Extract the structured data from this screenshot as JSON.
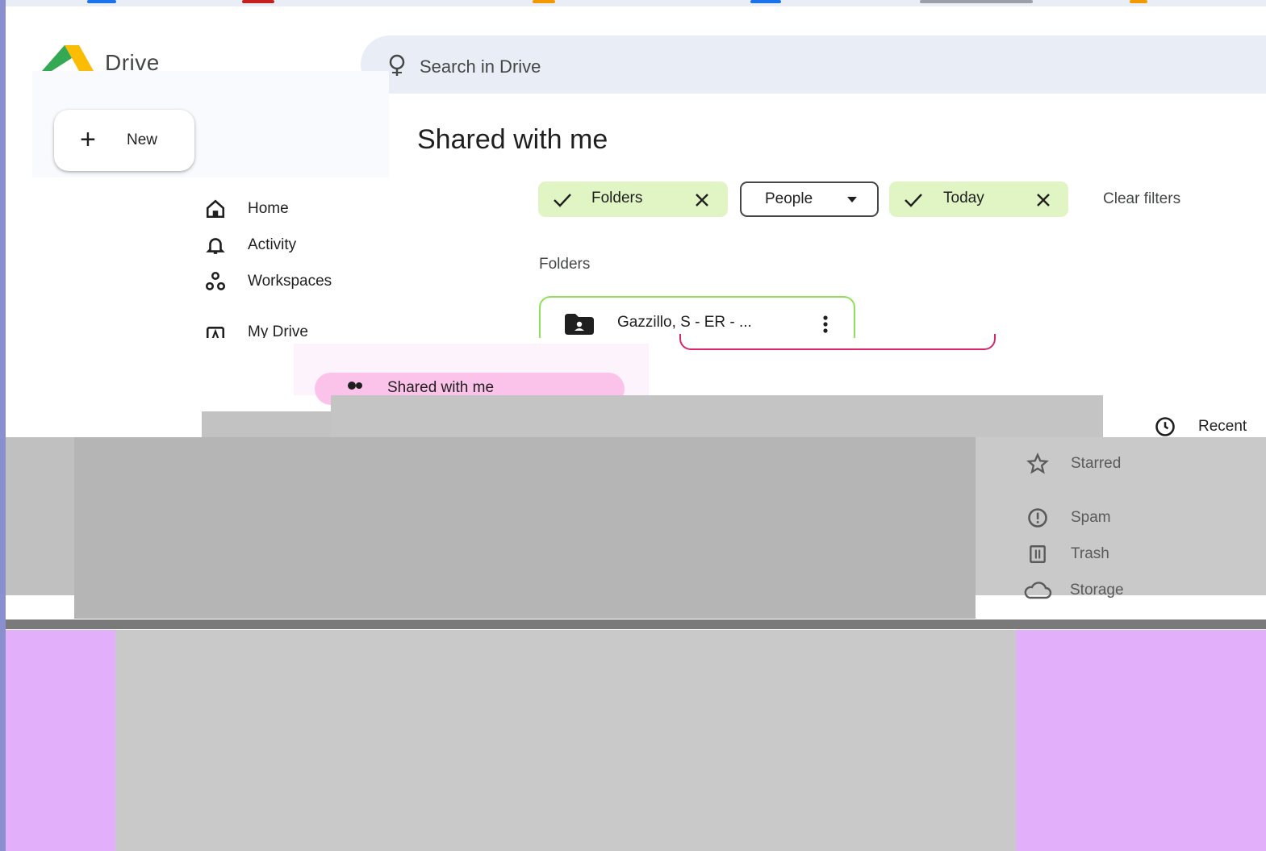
{
  "app": {
    "name": "Drive"
  },
  "search": {
    "placeholder": "Search in Drive"
  },
  "new_button": {
    "label": "New"
  },
  "nav": {
    "items": [
      {
        "label": "Home",
        "icon": "home-icon"
      },
      {
        "label": "Activity",
        "icon": "bell-icon"
      },
      {
        "label": "Workspaces",
        "icon": "workspaces-icon"
      },
      {
        "label": "My Drive",
        "icon": "my-drive-icon"
      },
      {
        "label": "Shared with me",
        "icon": "people-icon",
        "selected": true
      }
    ]
  },
  "right_nav": {
    "items": [
      {
        "label": "Recent",
        "icon": "clock-icon"
      },
      {
        "label": "Starred",
        "icon": "star-icon"
      },
      {
        "label": "Spam",
        "icon": "spam-icon"
      },
      {
        "label": "Trash",
        "icon": "trash-icon"
      },
      {
        "label": "Storage",
        "icon": "cloud-icon"
      }
    ]
  },
  "main": {
    "title": "Shared with me",
    "filters": [
      {
        "label": "Folders",
        "state": "active"
      },
      {
        "label": "People",
        "state": "dropdown"
      },
      {
        "label": "Today",
        "state": "active"
      }
    ],
    "clear_filters": "Clear filters",
    "section_label": "Folders",
    "folders": [
      {
        "name": "Gazzillo, S - ER - ..."
      }
    ]
  },
  "colors": {
    "chip_active": "#e1f5c4",
    "nav_selected": "#fbc3ea",
    "search_bg": "#e9eef6",
    "accent_pink": "#d7266b",
    "glitch_violet": "#e2b0fb"
  }
}
